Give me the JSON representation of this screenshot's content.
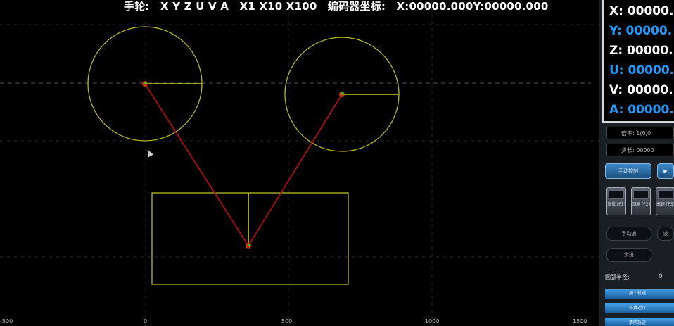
{
  "status_bar": {
    "handwheel_label": "手轮:",
    "axes": "X Y Z U V A",
    "multipliers": "X1 X10 X100",
    "encoder_label": "编码器坐标:",
    "encoder_x": "X:00000.000",
    "encoder_y": "Y:00000.000"
  },
  "coordinates": [
    {
      "label": "X: 00000.",
      "color": "#ffffff"
    },
    {
      "label": "Y: 00000.",
      "color": "#1e9bff"
    },
    {
      "label": "Z: 00000.",
      "color": "#ffffff"
    },
    {
      "label": "U: 00000.",
      "color": "#1e9bff"
    },
    {
      "label": "V: 00000.",
      "color": "#ffffff"
    },
    {
      "label": "A: 00000.",
      "color": "#1e9bff"
    }
  ],
  "info_fields": [
    "倍率: 1(0,0",
    "步长: 00000"
  ],
  "buttons": {
    "mode_button": "手动控制",
    "play_button": "▶",
    "mini_keys": [
      "复位 [F1]",
      "回原 [F2]",
      "高速 [F3]"
    ],
    "hand_button": "手动速",
    "set_button": "设",
    "step_button": "步进"
  },
  "radius": {
    "label": "圆弧半径:",
    "value": "0"
  },
  "blue_bars": [
    "加工轨迹",
    "仿真运行",
    "清除轨迹"
  ],
  "axis_ticks": [
    "-500",
    "0",
    "500",
    "1000",
    "1500"
  ],
  "colors": {
    "background": "#000000",
    "grid": "#2a2a2a",
    "geometry": "#c8c820",
    "path": "#a01010",
    "accent_blue": "#1e9bff"
  }
}
